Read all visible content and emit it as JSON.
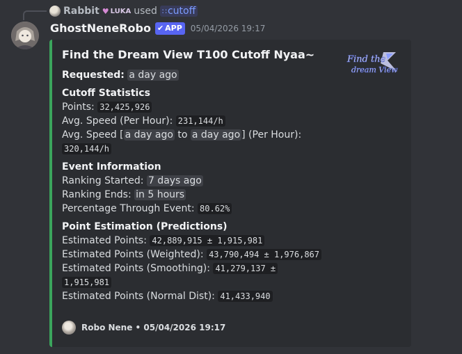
{
  "reply": {
    "user": "Rabbit",
    "tag": "LUKA",
    "verb": "used",
    "command": "cutoff",
    "command_icon": "slash-command-icon"
  },
  "message": {
    "author": "GhostNeneRobo",
    "badge": "APP",
    "timestamp": "05/04/2026 19:17"
  },
  "embed": {
    "accent_color": "#3ba55c",
    "title": "Find the Dream View T100 Cutoff Nyaa~",
    "thumbnail_text_1": "Find the",
    "thumbnail_text_2": "dream View",
    "requested_label": "Requested:",
    "requested_value": "a day ago",
    "cutoff_title": "Cutoff Statistics",
    "points_label": "Points:",
    "points_value": "32,425,926",
    "avg_speed_label": "Avg. Speed (Per Hour):",
    "avg_speed_value": "231,144/h",
    "avg_speed_range_prefix": "Avg. Speed [",
    "avg_speed_range_from": "a day ago",
    "avg_speed_range_to_word": "to",
    "avg_speed_range_to": "a day ago",
    "avg_speed_range_suffix": "] (Per Hour):",
    "avg_speed_range_value": "320,144/h",
    "event_title": "Event Information",
    "ranking_started_label": "Ranking Started:",
    "ranking_started_value": "7 days ago",
    "ranking_ends_label": "Ranking Ends:",
    "ranking_ends_value": "in 5 hours",
    "percentage_label": "Percentage Through Event:",
    "percentage_value": "80.62%",
    "estimation_title": "Point Estimation (Predictions)",
    "est_points_label": "Estimated Points:",
    "est_points_value": "42,889,915 ± 1,915,981",
    "est_weighted_label": "Estimated Points (Weighted):",
    "est_weighted_value": "43,790,494 ± 1,976,867",
    "est_smoothing_label": "Estimated Points (Smoothing):",
    "est_smoothing_value_1": "41,279,137 ±",
    "est_smoothing_value_2": "1,915,981",
    "est_normal_label": "Estimated Points (Normal Dist):",
    "est_normal_value": "41,433,940",
    "footer_text": "Robo Nene • 05/04/2026 19:17"
  }
}
